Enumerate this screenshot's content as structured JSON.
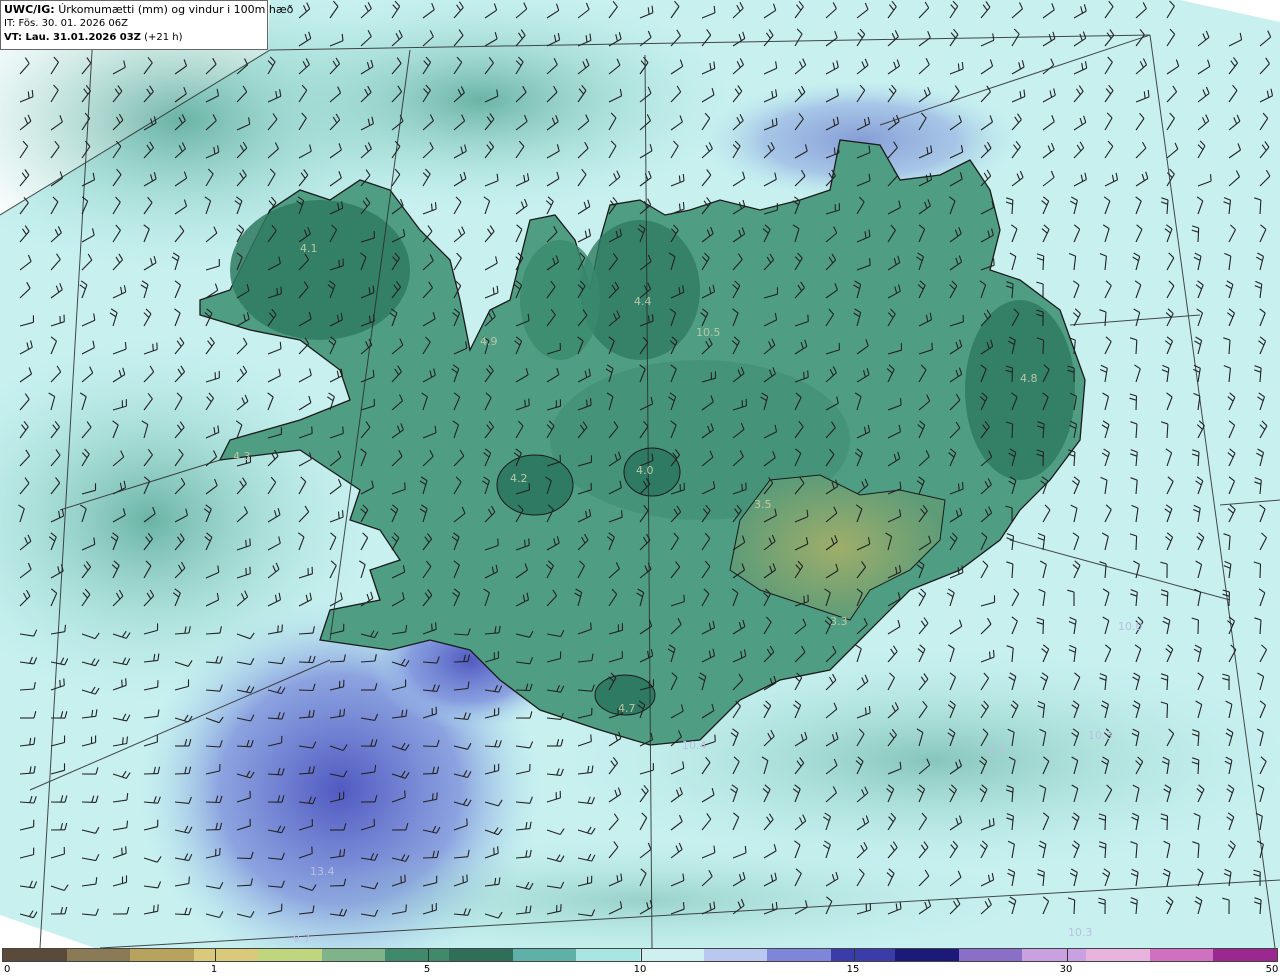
{
  "header": {
    "model": "UWC/IG:",
    "title": "Úrkomumætti (mm) og vindur i 100m hæð",
    "issue_time": "IT: Fös. 30. 01. 2026 06Z",
    "valid_prefix": "VT: Lau. 31.01.2026 03Z",
    "valid_suffix": " (+21 h)"
  },
  "colorbar": {
    "ticks": [
      "0",
      "1",
      "5",
      "10",
      "15",
      "30",
      "50"
    ],
    "colors": [
      "#5a4a3a",
      "#8a7a55",
      "#b8a35e",
      "#d9c97a",
      "#bfd67e",
      "#7fb38a",
      "#3e8a6a",
      "#2f6f5a",
      "#5fb0a8",
      "#a8e6e4",
      "#cfeff0",
      "#b9c8f0",
      "#7d86d8",
      "#3a3ca8",
      "#1b1a78",
      "#8a6fc8",
      "#c9a0e0",
      "#e9b3e0",
      "#d070c0",
      "#9a2890"
    ]
  },
  "labels": [
    {
      "text": "4.1"
    },
    {
      "text": "4.9"
    },
    {
      "text": "4.4"
    },
    {
      "text": "10.5"
    },
    {
      "text": "4.8"
    },
    {
      "text": "4.3"
    },
    {
      "text": "4.2"
    },
    {
      "text": "4.0"
    },
    {
      "text": "3.5"
    },
    {
      "text": "3.3"
    },
    {
      "text": "10.0"
    },
    {
      "text": "4.7"
    },
    {
      "text": "10.4"
    },
    {
      "text": "9.7"
    },
    {
      "text": "10.3"
    },
    {
      "text": "13.4"
    },
    {
      "text": "9.7"
    },
    {
      "text": "10.3"
    }
  ],
  "colors": {
    "land_dark": "#2f7a62",
    "land_mid": "#4f9e84",
    "land_low": "#7ea96a",
    "sea": "#bfeeee",
    "sea_blue": "#8fa6e0",
    "sea_deep": "#5561c6",
    "coast": "#1a1a1a",
    "wind": "#222222"
  }
}
